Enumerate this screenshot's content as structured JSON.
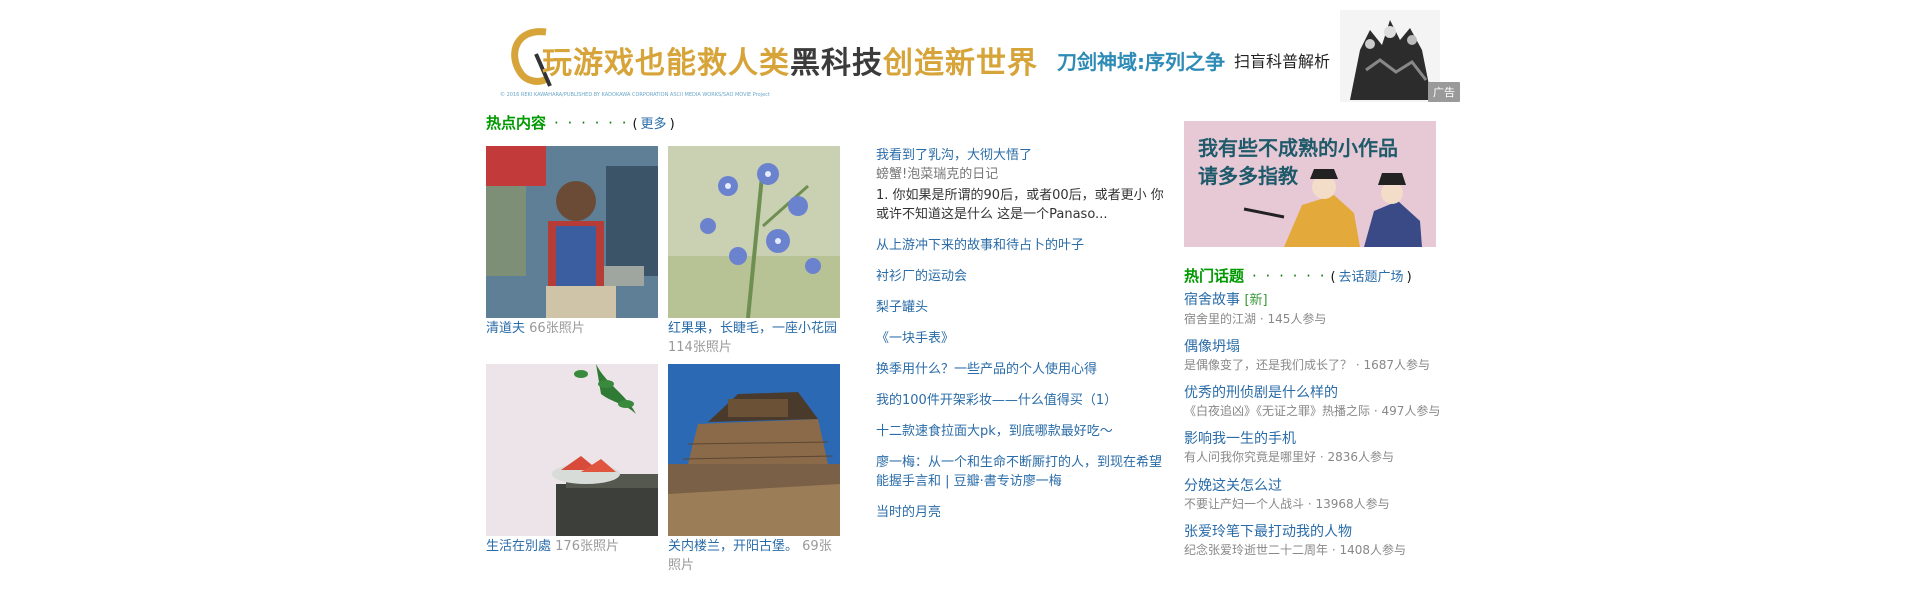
{
  "banner": {
    "headline_a": "玩游戏也能救人类",
    "headline_b": "黑科技",
    "headline_c": "创造新世界",
    "game_name": "刀剑神域:序列之争",
    "tagline": "扫盲科普解析",
    "fine_print": "© 2016 REKI KAWAHARA/PUBLISHED BY KADOKAWA CORPORATION ASCII MEDIA WORKS/SAO MOVIE Project",
    "ad_label": "广告"
  },
  "hot_content": {
    "title": "热点内容",
    "dots": "· · · · · ·",
    "more_open": "(",
    "more_label": "更多",
    "more_close": ")",
    "albums": [
      {
        "name": "清道夫",
        "count": "66张照片",
        "colors": {
          "bg": "#4d6e86",
          "accent": "#c23a3a"
        }
      },
      {
        "name": "红果果，长睫毛，一座小花园",
        "count": "114张照片",
        "colors": {
          "bg": "#bfc9a6",
          "accent": "#5f79c8"
        }
      },
      {
        "name": "生活在別處",
        "count": "176张照片",
        "colors": {
          "bg": "#ece6ea",
          "accent": "#d84a3a"
        }
      },
      {
        "name": "关内楼兰，开阳古堡。",
        "count": "69张照片",
        "colors": {
          "bg": "#2b69b5",
          "accent": "#8a6a48"
        }
      }
    ]
  },
  "middle": {
    "first_title": "我看到了乳沟，大彻大悟了",
    "first_source": "螃蟹!泡菜瑞克的日记",
    "first_excerpt": "1. 你如果是所谓的90后，或者00后，或者更小 你或许不知道这是什么 这是一个Panaso...",
    "links": [
      "从上游冲下来的故事和待占卜的叶子",
      "衬衫厂的运动会",
      "梨子罐头",
      "《一块手表》",
      "换季用什么？一些产品的个人使用心得",
      "我的100件开架彩妆——什么值得买（1）",
      "十二款速食拉面大pk，到底哪款最好吃～",
      "廖一梅：从一个和生命不断厮打的人，到现在希望能握手言和 | 豆瓣·書专访廖一梅",
      "当时的月亮"
    ]
  },
  "right_ad": {
    "line1": "我有些不成熟的小作品",
    "line2": "请多多指教"
  },
  "hot_topics": {
    "title": "热门话题",
    "dots": "· · · · · ·",
    "link_open": "(",
    "link_label": "去话题广场",
    "link_close": ")",
    "items": [
      {
        "title": "宿舍故事",
        "badge": "[新]",
        "sub": "宿舍里的江湖 · 145人参与"
      },
      {
        "title": "偶像坍塌",
        "badge": "",
        "sub": "是偶像变了，还是我们成长了？ · 1687人参与"
      },
      {
        "title": "优秀的刑侦剧是什么样的",
        "badge": "",
        "sub": "《白夜追凶》《无证之罪》热播之际 · 497人参与"
      },
      {
        "title": "影响我一生的手机",
        "badge": "",
        "sub": "有人问我你究竟是哪里好 · 2836人参与"
      },
      {
        "title": "分娩这关怎么过",
        "badge": "",
        "sub": "不要让产妇一个人战斗 · 13968人参与"
      },
      {
        "title": "张爱玲笔下最打动我的人物",
        "badge": "",
        "sub": "纪念张爱玲逝世二十二周年 · 1408人参与"
      }
    ]
  }
}
